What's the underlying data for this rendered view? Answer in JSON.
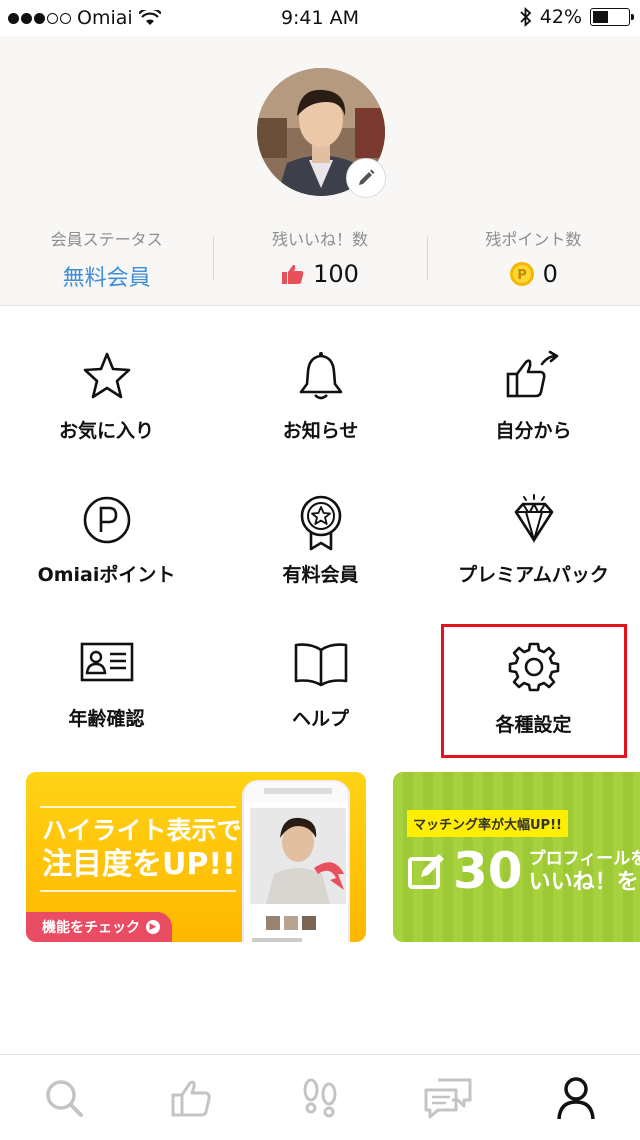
{
  "status_bar": {
    "carrier": "Omiai",
    "time": "9:41 AM",
    "battery": "42%"
  },
  "profile": {
    "stats": [
      {
        "label": "会員ステータス",
        "value": "無料会員"
      },
      {
        "label": "残いいね！数",
        "value": "100",
        "icon": "thumbs-up-icon"
      },
      {
        "label": "残ポイント数",
        "value": "0",
        "icon": "coin-icon"
      }
    ]
  },
  "menu": [
    {
      "label": "お気に入り",
      "icon": "star-icon"
    },
    {
      "label": "お知らせ",
      "icon": "bell-icon"
    },
    {
      "label": "自分から",
      "icon": "thumbs-up-share-icon"
    },
    {
      "label": "Omiaiポイント",
      "icon": "point-icon"
    },
    {
      "label": "有料会員",
      "icon": "badge-icon"
    },
    {
      "label": "プレミアムパック",
      "icon": "diamond-icon"
    },
    {
      "label": "年齢確認",
      "icon": "id-card-icon"
    },
    {
      "label": "ヘルプ",
      "icon": "book-icon"
    },
    {
      "label": "各種設定",
      "icon": "gear-icon"
    }
  ],
  "banners": {
    "b1": {
      "line1": "ハイライト表示で",
      "line2": "注目度をUP!!",
      "cta": "機能をチェック"
    },
    "b2": {
      "tag": "マッチング率が大幅UP!!",
      "num": "30",
      "text1": "プロフィールを",
      "text2": "いいね！を"
    }
  },
  "tabbar": [
    {
      "icon": "search-icon"
    },
    {
      "icon": "thumbs-up-icon"
    },
    {
      "icon": "footprints-icon"
    },
    {
      "icon": "messages-icon"
    },
    {
      "icon": "person-icon"
    }
  ],
  "colors": {
    "accent_blue": "#3f8fd8",
    "like_red": "#e8505b",
    "highlight": "#e5131d"
  }
}
